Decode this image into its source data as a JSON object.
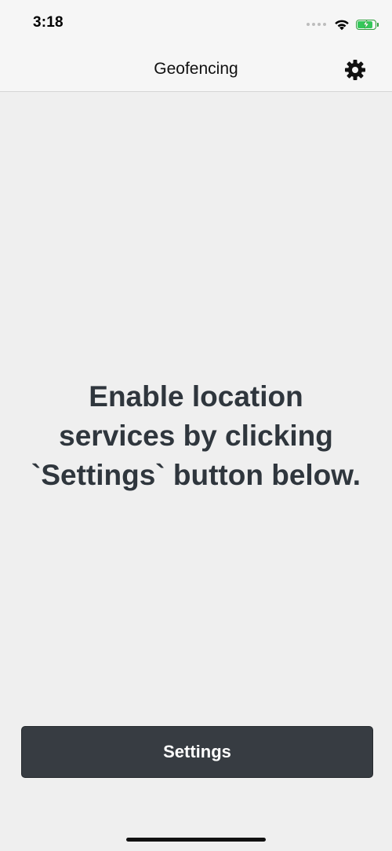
{
  "status_bar": {
    "time": "3:18",
    "icons": [
      "signal-dots-icon",
      "wifi-icon",
      "battery-charging-icon"
    ],
    "battery_color": "#34c759"
  },
  "nav_bar": {
    "title": "Geofencing",
    "right_icon": "gear-icon"
  },
  "main": {
    "message": "Enable location services by clicking `Settings` button below."
  },
  "footer": {
    "button_label": "Settings",
    "button_color": "#373c42"
  }
}
